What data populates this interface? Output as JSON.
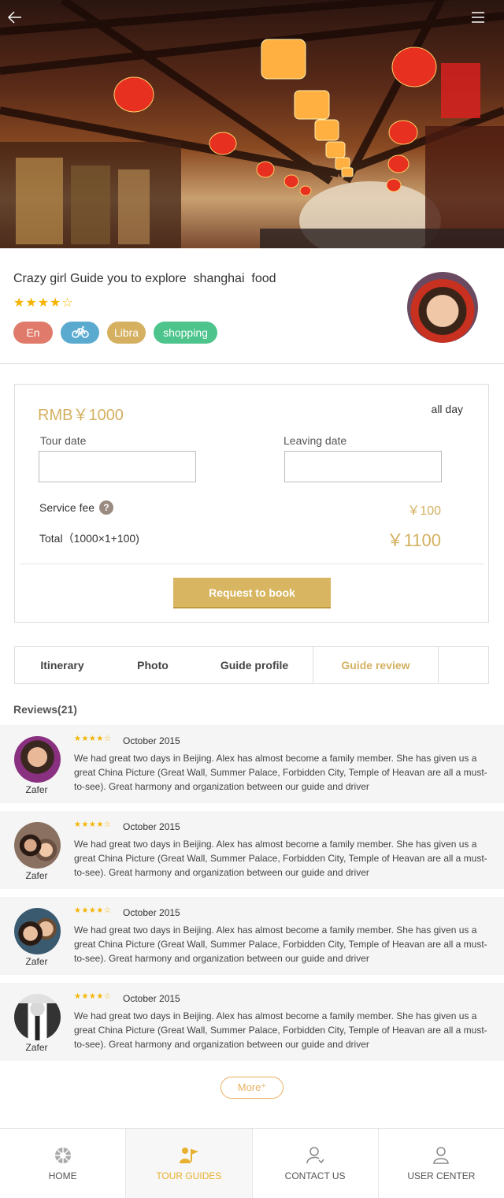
{
  "hero": {
    "back_icon": "back-arrow-icon",
    "menu_icon": "hamburger-menu-icon"
  },
  "guide": {
    "title": "Crazy girl Guide you to explore  shanghai  food",
    "rating": 4,
    "stars": "★★★★☆",
    "tags": {
      "language": "En",
      "bike_icon": "bicycle-icon",
      "sign": "Libra",
      "interest": "shopping"
    }
  },
  "booking": {
    "price": "RMB￥1000",
    "duration": "all day",
    "tour_date_label": "Tour date",
    "leaving_date_label": "Leaving date",
    "service_fee_label": "Service fee",
    "help_icon": "?",
    "service_fee_value": "￥100",
    "total_label": "Total（1000×1+100)",
    "total_value": "￥1100",
    "book_button": "Request to book"
  },
  "tabs": [
    "Itinerary",
    "Photo",
    "Guide profile",
    "Guide review"
  ],
  "active_tab": "Guide review",
  "reviews_title": "Reviews(21)",
  "reviews": [
    {
      "name": "Zafer",
      "stars": "★★★★☆",
      "rating": 4,
      "date": "October 2015",
      "text": "We had great two days in Beijing. Alex has almost become a family member. She has given us a great China Picture (Great Wall, Summer Palace, Forbidden City, Temple of Heavan are all a must-to-see). Great harmony and organization between our guide and driver"
    },
    {
      "name": "Zafer",
      "stars": "★★★★☆",
      "rating": 4,
      "date": "October 2015",
      "text": "We had great two days in Beijing. Alex has almost become a family member. She has given us a great China Picture (Great Wall, Summer Palace, Forbidden City, Temple of Heavan are all a must-to-see). Great harmony and organization between our guide and driver"
    },
    {
      "name": "Zafer",
      "stars": "★★★★☆",
      "rating": 4,
      "date": "October 2015",
      "text": "We had great two days in Beijing. Alex has almost become a family member. She has given us a great China Picture (Great Wall, Summer Palace, Forbidden City, Temple of Heavan are all a must-to-see). Great harmony and organization between our guide and driver"
    },
    {
      "name": "Zafer",
      "stars": "★★★★☆",
      "rating": 4,
      "date": "October 2015",
      "text": "We had great two days in Beijing. Alex has almost become a family member. She has given us a great China Picture (Great Wall, Summer Palace, Forbidden City, Temple of Heavan are all a must-to-see). Great harmony and organization between our guide and driver"
    }
  ],
  "more_button": "More⁺",
  "bottom_nav": [
    {
      "label": "HOME",
      "icon": "home-icon"
    },
    {
      "label": "TOUR GUIDES",
      "icon": "tour-guides-flag-icon"
    },
    {
      "label": "CONTACT US",
      "icon": "contact-user-icon"
    },
    {
      "label": "USER CENTER",
      "icon": "user-center-icon"
    }
  ],
  "colors": {
    "accent": "#d4b060",
    "active_nav": "#e8b030",
    "star": "#f4b400"
  }
}
